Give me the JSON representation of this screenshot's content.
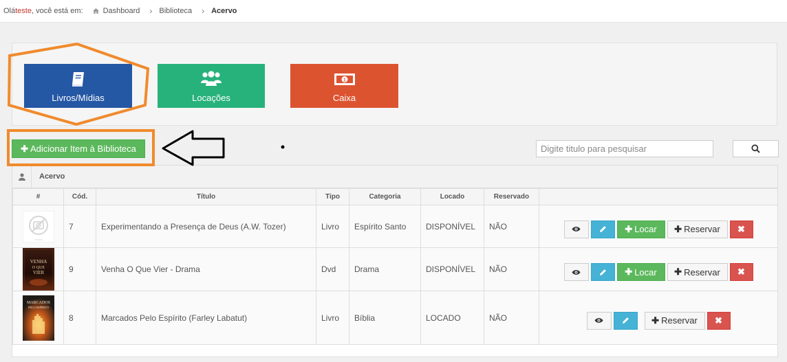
{
  "breadcrumb": {
    "greeting_prefix": "Olá ",
    "user": "teste",
    "greeting_suffix": ", você está em:",
    "items": [
      "Dashboard",
      "Biblioteca",
      "Acervo"
    ]
  },
  "tiles": [
    {
      "label": "Livros/Mídias",
      "icon": "book-icon",
      "color": "#2457a4"
    },
    {
      "label": "Locações",
      "icon": "users-icon",
      "color": "#27b27b"
    },
    {
      "label": "Caixa",
      "icon": "money-icon",
      "color": "#dc5330"
    }
  ],
  "toolbar": {
    "add_label": "Adicionar Item à Biblioteca",
    "search_placeholder": "Digite titulo para pesquisar"
  },
  "table": {
    "title": "Acervo",
    "headers": [
      "#",
      "Cód.",
      "Título",
      "Tipo",
      "Categoria",
      "Locado",
      "Reservado"
    ],
    "rows": [
      {
        "cod": "7",
        "titulo": "Experimentando a Presença de Deus (A.W. Tozer)",
        "tipo": "Livro",
        "categoria": "Espírito Santo",
        "locado": "DISPONÍVEL",
        "reservado": "NÃO",
        "cover": "no-image"
      },
      {
        "cod": "9",
        "titulo": "Venha O Que Vier - Drama",
        "tipo": "Dvd",
        "categoria": "Drama",
        "locado": "DISPONÍVEL",
        "reservado": "NÃO",
        "cover": "venha-o-que-vier"
      },
      {
        "cod": "8",
        "titulo": "Marcados Pelo Espírito (Farley Labatut)",
        "tipo": "Livro",
        "categoria": "Bíblia",
        "locado": "LOCADO",
        "reservado": "NÃO",
        "cover": "marcados-pelo-espirito"
      }
    ]
  },
  "actions": {
    "locar_label": "Locar",
    "reservar_label": "Reservar"
  },
  "annotation_colors": {
    "highlight": "#f08a2c",
    "arrow": "#000000"
  }
}
